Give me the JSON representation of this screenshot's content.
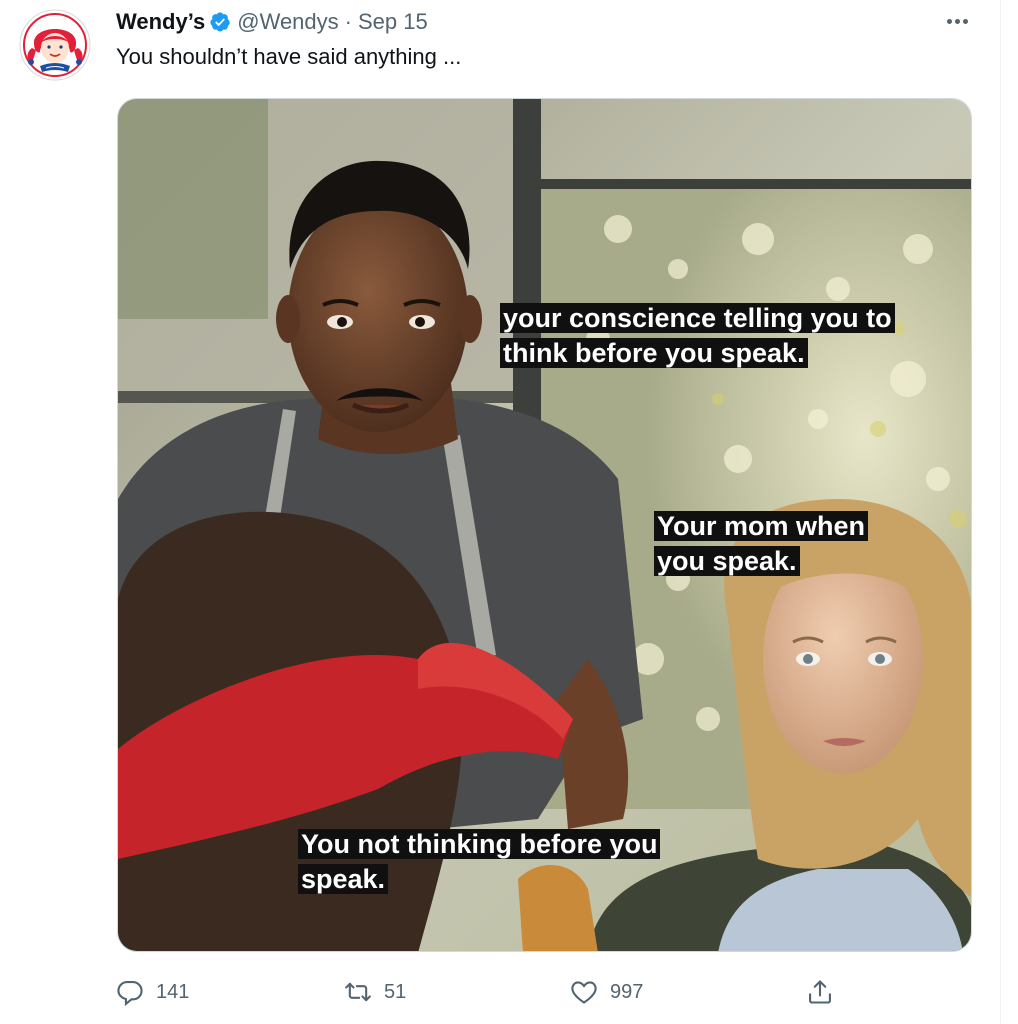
{
  "tweet": {
    "author_name": "Wendy’s",
    "handle": "@Wendys",
    "separator": "·",
    "date": "Sep 15",
    "text": "You shouldn’t have said anything ...",
    "avatar_icon": "wendys-logo-icon",
    "verified_icon": "verified-badge-icon"
  },
  "media": {
    "captions": [
      "your conscience telling you to think before you speak.",
      "Your mom when you speak.",
      "You not thinking before you speak."
    ]
  },
  "actions": {
    "reply_count": "141",
    "retweet_count": "51",
    "like_count": "997"
  },
  "colors": {
    "verified": "#1d9bf0",
    "secondary_text": "#536471",
    "primary_text": "#0f1419"
  }
}
